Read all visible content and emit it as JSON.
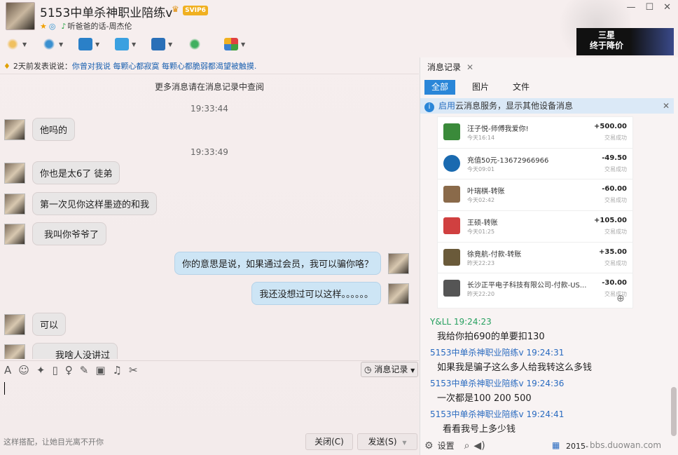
{
  "header": {
    "title": "5153中单杀神职业陪练v",
    "vip_badge": "SVIP6",
    "signature": "听爸爸的话-周杰伦",
    "window_controls": [
      "minimize",
      "maximize",
      "close"
    ]
  },
  "ad": {
    "line1": "三星",
    "line2": "终于降价"
  },
  "announcement": {
    "prefix": "2天前发表说说：",
    "text": "你曾对我说 每颗心都寂寞 每颗心都脆弱都渴望被触摸."
  },
  "more_messages": "更多消息请在消息记录中查阅",
  "chat": {
    "timestamps": [
      "19:33:44",
      "19:33:49"
    ],
    "messages": [
      {
        "from": "other",
        "text": "他吗的"
      },
      {
        "from": "other",
        "text": "你也是太6了 徒弟"
      },
      {
        "from": "other",
        "text": "第一次见你这样墨迹的和我"
      },
      {
        "from": "other",
        "text": "我叫你爷爷了"
      },
      {
        "from": "me",
        "text": "你的意思是说，如果通过会员，我可以骗你咯？"
      },
      {
        "from": "me",
        "text": "我还没想过可以这样。。。。。。"
      },
      {
        "from": "other",
        "text": "可以"
      },
      {
        "from": "other",
        "text": "我啥人没讲过"
      }
    ]
  },
  "input": {
    "history_button": "消息记录",
    "hint": "这样搭配，让她目光离不开你",
    "close_button": "关闭(C)",
    "send_button": "发送(S)"
  },
  "right_panel": {
    "tab_title": "消息记录",
    "filters": [
      "全部",
      "图片",
      "文件"
    ],
    "cloud_notice_link": "启用",
    "cloud_notice_text": "云消息服务，显示其他设备消息",
    "transactions": [
      {
        "name": "汪子悦-师傅我爱你!",
        "time": "今天16:14",
        "amount": "+500.00",
        "status": "交易成功",
        "color": "#3a8a3a"
      },
      {
        "name": "充值50元-13672966966",
        "time": "今天09:01",
        "amount": "-49.50",
        "status": "交易成功",
        "color": "#1a6ab0"
      },
      {
        "name": "叶瑞棋-转账",
        "time": "今天02:42",
        "amount": "-60.00",
        "status": "交易成功",
        "color": "#8a6a4a"
      },
      {
        "name": "王硕-转账",
        "time": "今天01:25",
        "amount": "+105.00",
        "status": "交易成功",
        "color": "#d04040"
      },
      {
        "name": "徐竟航-付款-转账",
        "time": "昨天22:23",
        "amount": "+35.00",
        "status": "交易成功",
        "color": "#6a5a3a"
      },
      {
        "name": "长沙正平电子科技有限公司-付款-US...",
        "time": "昨天22:20",
        "amount": "-30.00",
        "status": "交易成功",
        "color": "#555555"
      }
    ],
    "history": [
      {
        "sender": "Y&LL 19:24:23",
        "style": "g",
        "text": "我给你拍690的单要扣130"
      },
      {
        "sender": "5153中单杀神职业陪练v 19:24:31",
        "style": "b",
        "text": "如果我是骗子这么多人给我转这么多钱"
      },
      {
        "sender": "5153中单杀神职业陪练v 19:24:36",
        "style": "b",
        "text": "一次都是100 200 500"
      },
      {
        "sender": "5153中单杀神职业陪练v 19:24:41",
        "style": "b",
        "text": "看看我号上多少钱"
      }
    ],
    "footer": {
      "settings": "设置",
      "date": "2015-",
      "watermark": "bbs.duowan.com"
    }
  }
}
